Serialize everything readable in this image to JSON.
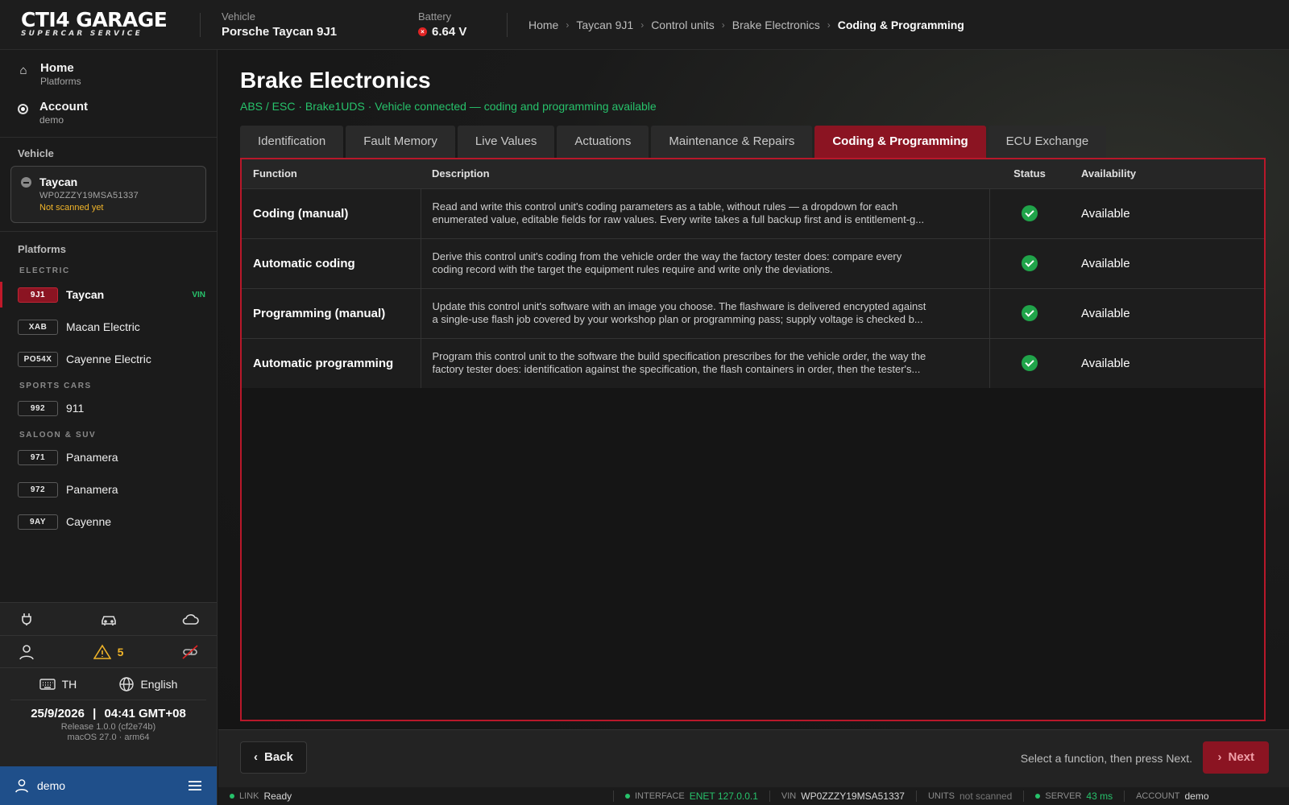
{
  "app": {
    "logo_main": "CTI4 GARAGE",
    "logo_sub": "SUPERCAR SERVICE"
  },
  "topbar": {
    "vehicle_label": "Vehicle",
    "vehicle_value": "Porsche Taycan 9J1",
    "battery_label": "Battery",
    "battery_value": "6.64 V",
    "battery_status_color": "#e02424",
    "breadcrumb": [
      "Home",
      "Taycan 9J1",
      "Control units",
      "Brake Electronics",
      "Coding & Programming"
    ]
  },
  "sidebar": {
    "nav": [
      {
        "title": "Home",
        "sub": "Platforms",
        "icon": "home-icon"
      },
      {
        "title": "Account",
        "sub": "demo",
        "icon": "radio-icon"
      }
    ],
    "vehicle_section": "Vehicle",
    "vehicle_card": {
      "title": "Taycan",
      "vin": "WP0ZZZY19MSA51337",
      "status": "Not scanned yet"
    },
    "platforms_section": "Platforms",
    "groups": [
      {
        "label": "ELECTRIC",
        "items": [
          {
            "code": "9J1",
            "name": "Taycan",
            "badge": "VIN",
            "active": true
          },
          {
            "code": "XAB",
            "name": "Macan Electric"
          },
          {
            "code": "PO54X",
            "name": "Cayenne Electric"
          }
        ]
      },
      {
        "label": "SPORTS CARS",
        "items": [
          {
            "code": "992",
            "name": "911"
          }
        ]
      },
      {
        "label": "SALOON & SUV",
        "items": [
          {
            "code": "971",
            "name": "Panamera"
          },
          {
            "code": "972",
            "name": "Panamera"
          },
          {
            "code": "9AY",
            "name": "Cayenne"
          }
        ]
      }
    ],
    "warning_count": "5",
    "keyboard_layout": "TH",
    "language": "English",
    "date": "25/9/2026",
    "time": "04:41 GMT+08",
    "release": "Release 1.0.0 (cf2e74b)",
    "os": "macOS 27.0 · arm64",
    "user": "demo"
  },
  "main": {
    "title": "Brake Electronics",
    "subtitle": "ABS / ESC · Brake1UDS · Vehicle connected — coding and programming available",
    "tabs": [
      "Identification",
      "Fault Memory",
      "Live Values",
      "Actuations",
      "Maintenance & Repairs",
      "Coding & Programming",
      "ECU Exchange"
    ],
    "active_tab": 5,
    "table": {
      "headers": [
        "Function",
        "Description",
        "Status",
        "Availability"
      ],
      "rows": [
        {
          "function": "Coding (manual)",
          "desc1": "Read and write this control unit's coding parameters as a table, without rules — a dropdown for each",
          "desc2": "enumerated value, editable fields for raw values. Every write takes a full backup first and is entitlement-g...",
          "availability": "Available"
        },
        {
          "function": "Automatic coding",
          "desc1": "Derive this control unit's coding from the vehicle order the way the factory tester does: compare every",
          "desc2": "coding record with the target the equipment rules require and write only the deviations.",
          "availability": "Available"
        },
        {
          "function": "Programming (manual)",
          "desc1": "Update this control unit's software with an image you choose. The flashware is delivered encrypted against",
          "desc2": "a single-use flash job covered by your workshop plan or programming pass; supply voltage is checked b...",
          "availability": "Available"
        },
        {
          "function": "Automatic programming",
          "desc1": "Program this control unit to the software the build specification prescribes for the vehicle order, the way the",
          "desc2": "factory tester does: identification against the specification, the flash containers in order, then the tester's...",
          "availability": "Available"
        }
      ]
    }
  },
  "footer": {
    "back_label": "Back",
    "hint": "Select a function, then press Next.",
    "next_label": "Next"
  },
  "statusbar": {
    "link_label": "LINK",
    "link_value": "Ready",
    "interface_label": "INTERFACE",
    "interface_value": "ENET 127.0.0.1",
    "vin_label": "VIN",
    "vin_value": "WP0ZZZY19MSA51337",
    "units_label": "UNITS",
    "units_value": "not scanned",
    "server_label": "SERVER",
    "server_value": "43 ms",
    "account_label": "ACCOUNT",
    "account_value": "demo"
  },
  "colors": {
    "accent": "#8b1422",
    "ok": "#27c26b",
    "warning": "#f0b429",
    "user_bar": "#1f4f8a"
  }
}
